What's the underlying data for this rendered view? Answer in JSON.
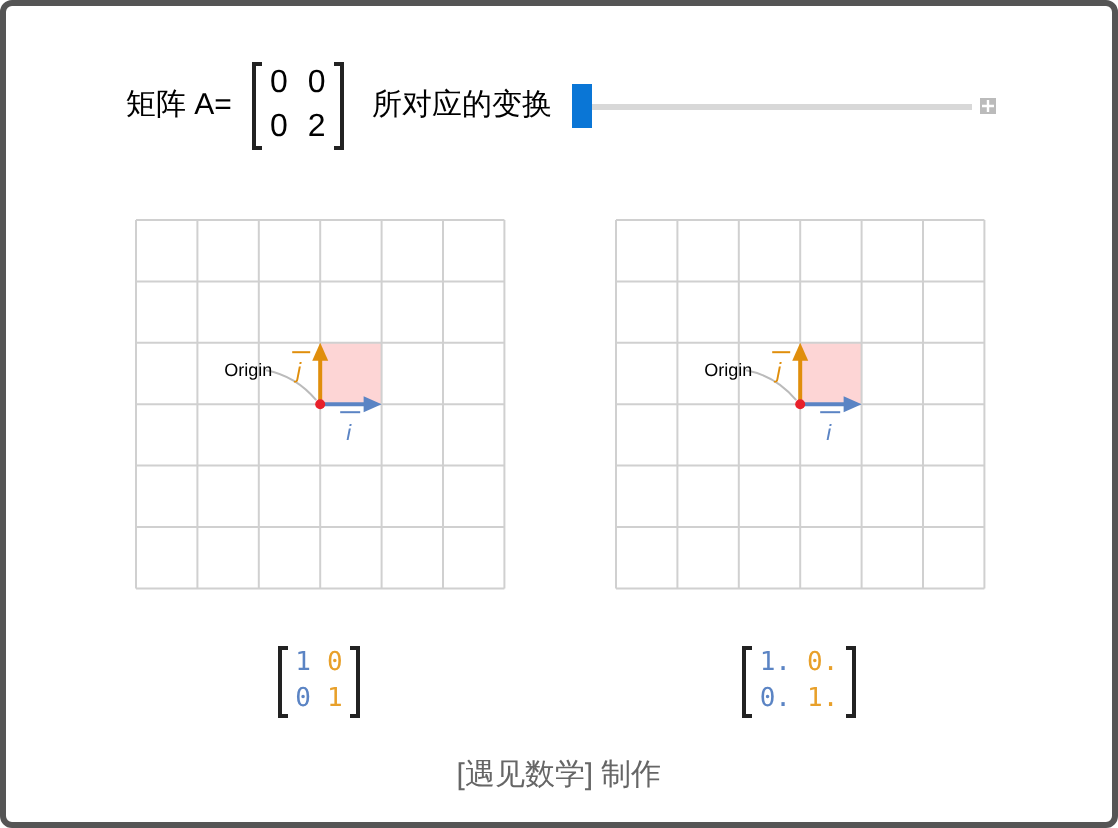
{
  "header": {
    "label": "矩阵 A=",
    "matrix": [
      [
        "0",
        "0"
      ],
      [
        "0",
        "2"
      ]
    ],
    "caption": "所对应的变换"
  },
  "slider": {
    "level": 0
  },
  "panels": [
    {
      "origin_label": "Origin",
      "i_label": "i",
      "j_label": "j",
      "matrix": {
        "columns": [
          {
            "color": "#5b84c4",
            "values": [
              "1",
              "0"
            ]
          },
          {
            "color": "#e8a02a",
            "values": [
              "0",
              "1"
            ]
          }
        ]
      }
    },
    {
      "origin_label": "Origin",
      "i_label": "i",
      "j_label": "j",
      "matrix": {
        "columns": [
          {
            "color": "#5b84c4",
            "values": [
              "1.",
              "0."
            ]
          },
          {
            "color": "#e8a02a",
            "values": [
              "0.",
              "1."
            ]
          }
        ]
      }
    }
  ],
  "footer": "[遇见数学] 制作"
}
